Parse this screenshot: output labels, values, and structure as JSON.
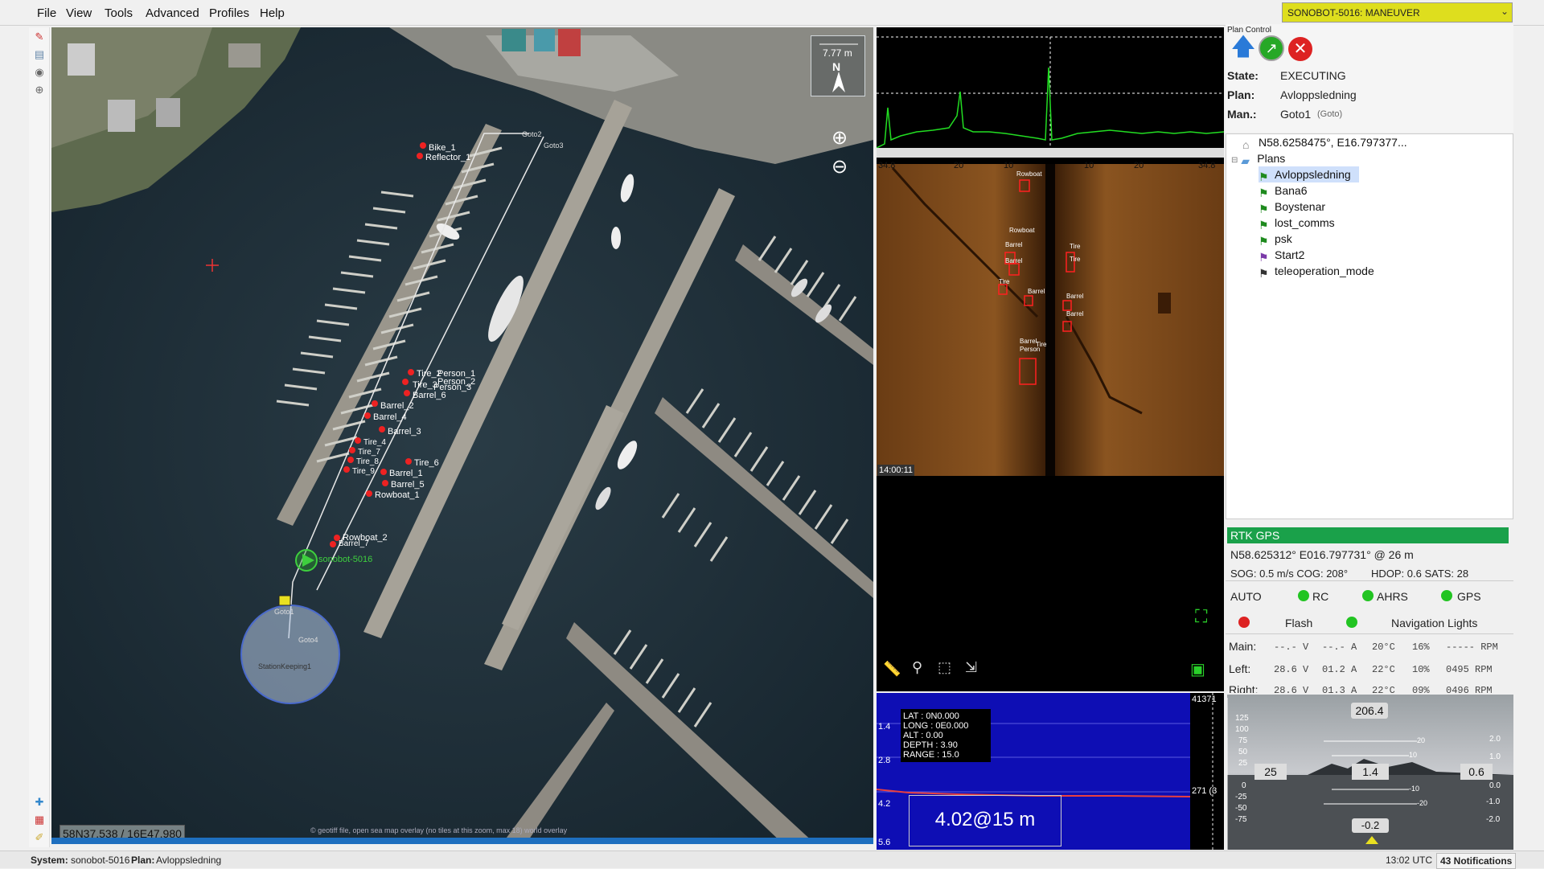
{
  "menu": [
    "File",
    "View",
    "Tools",
    "Advanced",
    "Profiles",
    "Help"
  ],
  "vehicle_select": "SONOBOT-5016: MANEUVER",
  "map": {
    "cursor_coords": "58N37.538 / 16E47.980",
    "credit": "© geotiff file, open sea map overlay (no tiles at this zoom, max 18) world overlay",
    "scale_label": "7.77 m",
    "north_label": "N",
    "vehicle_label": "sonobot-5016",
    "markers": [
      "Bike_1",
      "Reflector_1",
      "Tire_2",
      "Person_1",
      "Person_2",
      "Tire_3",
      "Person_3",
      "Barrel_6",
      "Barrel_2",
      "Barrel_4",
      "Barrel_3",
      "Tire_4",
      "Tire_7",
      "Tire_8",
      "Tire_9",
      "Tire_6",
      "Barrel_1",
      "Barrel_5",
      "Rowboat_1",
      "Rowboat_2",
      "Barrel_7"
    ],
    "waypoints": [
      "Goto1",
      "Goto2",
      "Goto3",
      "Goto4",
      "StationKeeping1"
    ]
  },
  "sss": {
    "scale_ticks": [
      "34.8",
      "20",
      "10",
      "10",
      "20",
      "34.8"
    ],
    "timestamp": "14:00:11",
    "targets": [
      "Rowboat",
      "Rowboat",
      "Barrel",
      "Barrel",
      "Tire",
      "Barrel",
      "Tire",
      "Tire",
      "Barrel",
      "Barrel",
      "Barrel",
      "Person",
      "Tire"
    ]
  },
  "echo": {
    "overlay": [
      "LAT : 0N0.000",
      "LONG : 0E0.000",
      "ALT : 0.00",
      "DEPTH : 3.90",
      "RANGE : 15.0"
    ],
    "depth_ticks": [
      "1.4",
      "2.8",
      "4.2",
      "5.6"
    ],
    "readout": "4.02@15 m",
    "right_top": "41371",
    "right_mid": "271 (3"
  },
  "plan_control": {
    "title": "Plan Control",
    "state_label": "State:",
    "state_value": "EXECUTING",
    "plan_label": "Plan:",
    "plan_value": "Avloppsledning",
    "man_label": "Man.:",
    "man_value": "Goto1",
    "man_type": "(Goto)"
  },
  "tree": {
    "root": "N58.6258475°, E16.797377...",
    "group": "Plans",
    "plans": [
      "Avloppsledning",
      "Bana6",
      "Boystenar",
      "lost_comms",
      "psk",
      "Start2",
      "teleoperation_mode"
    ],
    "selected_index": 0
  },
  "gps": {
    "header": "RTK GPS",
    "position": "N58.625312° E016.797731° @  26 m",
    "line2": "SOG: 0.5 m/s COG: 208°        HDOP: 0.6 SATS: 28"
  },
  "status": {
    "mode": "AUTO",
    "rc": "RC",
    "ahrs": "AHRS",
    "gps": "GPS",
    "flash": "Flash",
    "nav_lights": "Navigation Lights",
    "colors": {
      "green": "#22c422",
      "red": "#dd2222"
    },
    "motors": [
      {
        "label": "Main:",
        "v": "--.- V",
        "a": "--.- A",
        "temp": "20°C",
        "pct": "16%",
        "rpm": "----- RPM"
      },
      {
        "label": "Left:",
        "v": "28.6 V",
        "a": "01.2 A",
        "temp": "22°C",
        "pct": "10%",
        "rpm": "0495 RPM"
      },
      {
        "label": "Right:",
        "v": "28.6 V",
        "a": "01.3 A",
        "temp": "22°C",
        "pct": "09%",
        "rpm": "0496 RPM"
      }
    ]
  },
  "horizon": {
    "heading": "206.4",
    "speed": "25",
    "center": "1.4",
    "right_value": "0.6",
    "bottom_value": "-0.2",
    "left_scale": [
      "125",
      "100",
      "75",
      "50",
      "25",
      "0",
      "-25",
      "-50",
      "-75"
    ],
    "right_scale": [
      "2.0",
      "1.0",
      "0.0",
      "-1.0",
      "-2.0"
    ],
    "center_scale": [
      "20",
      "10",
      "-10",
      "-20"
    ]
  },
  "statusbar": {
    "system_label": "System:",
    "system_value": "sonobot-5016",
    "plan_label": "Plan:",
    "plan_value": "Avloppsledning",
    "time": "13:02 UTC",
    "notifications": "43 Notifications"
  }
}
